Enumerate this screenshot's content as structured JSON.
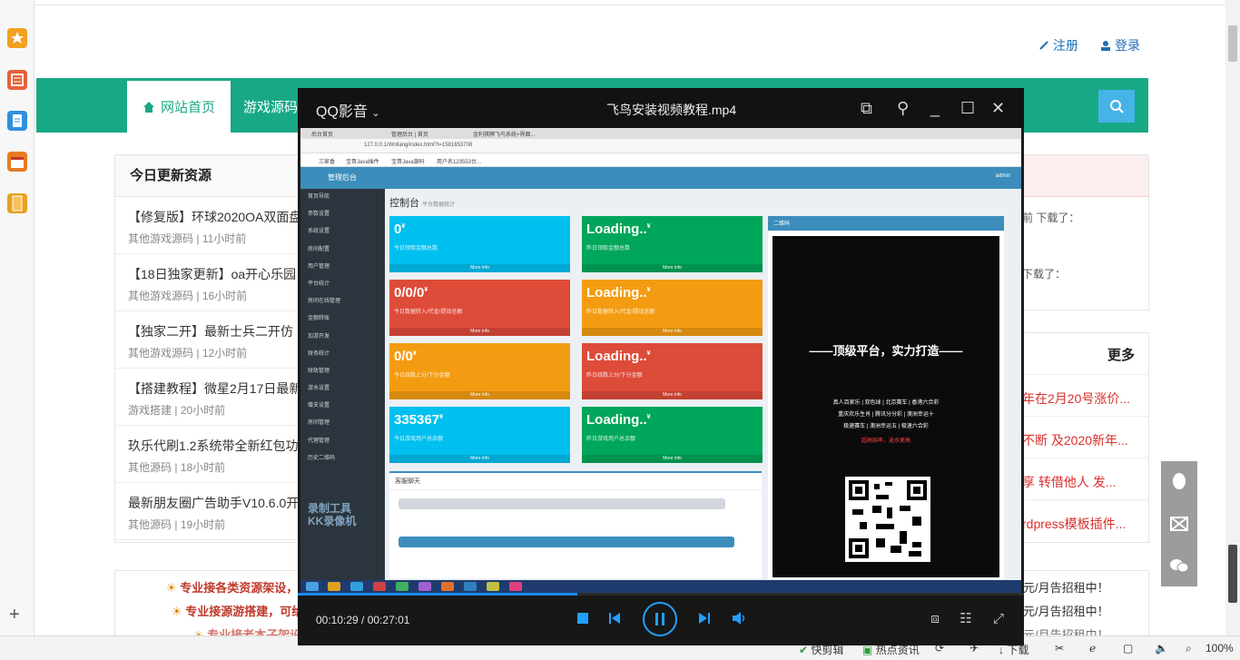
{
  "site": {
    "register_label": "注册",
    "login_label": "登录",
    "nav_home": "网站首页",
    "nav_games": "游戏源码",
    "updates_title": "今日更新资源",
    "resources": [
      {
        "title": "【修复版】环球2020OA双面盘",
        "category": "其他游戏源码",
        "time": "11小时前"
      },
      {
        "title": "【18日独家更新】oa开心乐园",
        "category": "其他游戏源码",
        "time": "16小时前"
      },
      {
        "title": "【独家二开】最新士兵二开仿",
        "category": "其他游戏源码",
        "time": "12小时前"
      },
      {
        "title": "【搭建教程】微星2月17日最新",
        "category": "游戏搭建",
        "time": "20小时前"
      },
      {
        "title": "玖乐代刷1.2系统带全新红包功",
        "category": "其他源码",
        "time": "18小时前"
      },
      {
        "title": "最新朋友圈广告助手V10.6.0开",
        "category": "其他源码",
        "time": "19小时前"
      }
    ],
    "right_panel1": [
      "前 下载了：",
      "下载了："
    ],
    "more_label": "更多",
    "right_links": [
      "年在2月20号涨价...",
      "不断 及2020新年...",
      "享 转借他人 发...",
      "rdpress模板插件..."
    ],
    "ads_left": [
      "专业接各类资源架设，可",
      "专业接源游搭建，可给",
      "专业接老本子架设"
    ],
    "ads_right": [
      "元/月告招租中！",
      "元/月告招租中！",
      "元/月告招租中！"
    ]
  },
  "statusbar": {
    "items": [
      "快剪辑",
      "热点资讯",
      "下载"
    ],
    "zoom": "100%"
  },
  "player": {
    "brand": "QQ影音",
    "file_title": "飞鸟安装视频教程.mp4",
    "time": "00:10:29 / 00:27:01",
    "progress_fraction": 0.385
  },
  "video": {
    "browser_tabs": [
      "后台首页",
      "管理后台 | 首页",
      "金利棋牌飞鸟系统+界面..."
    ],
    "address": "127.0.0.1/Wnllang/index.html?t=1581853708",
    "bookmarks": [
      "三家香",
      "宝哥Java插件",
      "宝哥Java源码",
      "用户名123553台..."
    ],
    "admin_title": "管理后台",
    "admin_user": "admin",
    "menu": [
      "首页导航",
      "参数设置",
      "系统设置",
      "房间配置",
      "用户管理",
      "平台统计",
      "房间在线管理",
      "金额转账",
      "加游开发",
      "财务统计",
      "财政管理",
      "游水设置",
      "赠支设置",
      "房间管理",
      "代理管理",
      "历史二维码"
    ],
    "page_title": "控制台",
    "page_subtitle": "平台数据统计",
    "boxes": [
      {
        "value": "0",
        "unit": "¥",
        "label": "今日领取金额总数",
        "more": "More info",
        "color": "#00c0ef"
      },
      {
        "value": "Loading..",
        "unit": "¥",
        "label": "昨日领取金额总数",
        "more": "More info",
        "color": "#00a65a"
      },
      {
        "value": "0/0/0",
        "unit": "¥",
        "label": "今日数据转入/代金/提现总额",
        "more": "More info",
        "color": "#dd4b39"
      },
      {
        "value": "Loading..",
        "unit": "¥",
        "label": "昨日数据转入/代金/提现总额",
        "more": "More info",
        "color": "#f39c12"
      },
      {
        "value": "0/0",
        "unit": "¥",
        "label": "今日线数上分/下分金额",
        "more": "More info",
        "color": "#f39c12"
      },
      {
        "value": "Loading..",
        "unit": "¥",
        "label": "昨日线数上分/下分金额",
        "more": "More info",
        "color": "#dd4b39"
      },
      {
        "value": "335367",
        "unit": "¥",
        "label": "今日游戏用户总余额",
        "more": "More info",
        "color": "#00c0ef"
      },
      {
        "value": "Loading..",
        "unit": "¥",
        "label": "昨日游戏用户总余额",
        "more": "More info",
        "color": "#00a65a"
      }
    ],
    "chat_title": "客服聊天",
    "qr_title": "二维码",
    "slogan": "——顶级平台，实力打造——",
    "poster_lines": [
      "真人百家乐 | 双色球 | 北京赛车 | 香港六合彩",
      "重庆欢乐生肖 | 腾讯分分彩 | 澳洲幸运十",
      "极速赛车 | 澳洲幸运五 | 极速六合彩",
      "超高赔率，返水更高"
    ],
    "watermark": [
      "录制工具",
      "KK录像机"
    ]
  },
  "colors": {
    "nav_green": "#19a886",
    "player_blue": "#1d8ae8",
    "admin_blue": "#3c8dbc"
  }
}
